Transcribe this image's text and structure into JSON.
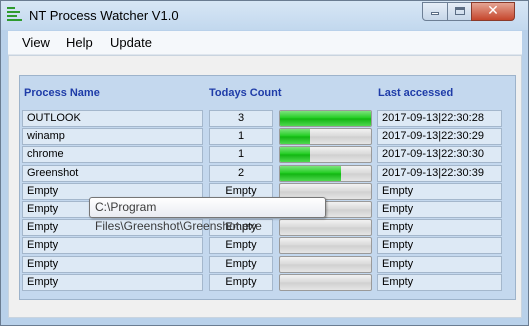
{
  "window": {
    "title": "NT Process Watcher V1.0"
  },
  "menu": {
    "items": [
      {
        "label": "View"
      },
      {
        "label": "Help"
      },
      {
        "label": "Update"
      }
    ]
  },
  "table": {
    "headers": {
      "name": "Process Name",
      "count": "Todays Count",
      "last": "Last accessed"
    },
    "rows": [
      {
        "name": "OUTLOOK",
        "count": "3",
        "progress": 1.0,
        "last": "2017-09-13|22:30:28"
      },
      {
        "name": "winamp",
        "count": "1",
        "progress": 0.33,
        "last": "2017-09-13|22:30:29"
      },
      {
        "name": "chrome",
        "count": "1",
        "progress": 0.33,
        "last": "2017-09-13|22:30:30"
      },
      {
        "name": "Greenshot",
        "count": "2",
        "progress": 0.67,
        "last": "2017-09-13|22:30:39"
      },
      {
        "name": "Empty",
        "count": "Empty",
        "progress": 0,
        "last": "Empty"
      },
      {
        "name": "Empty",
        "count": "Empty",
        "progress": 0,
        "last": "Empty"
      },
      {
        "name": "Empty",
        "count": "Empty",
        "progress": 0,
        "last": "Empty"
      },
      {
        "name": "Empty",
        "count": "Empty",
        "progress": 0,
        "last": "Empty"
      },
      {
        "name": "Empty",
        "count": "Empty",
        "progress": 0,
        "last": "Empty"
      },
      {
        "name": "Empty",
        "count": "Empty",
        "progress": 0,
        "last": "Empty"
      }
    ]
  },
  "tooltip": {
    "text": "C:\\Program Files\\Greenshot\\Greenshot.exe"
  },
  "colors": {
    "progress_fill": "#1ccb1c",
    "header_text": "#1f3ca8",
    "panel_bg": "#c4d8ee"
  }
}
